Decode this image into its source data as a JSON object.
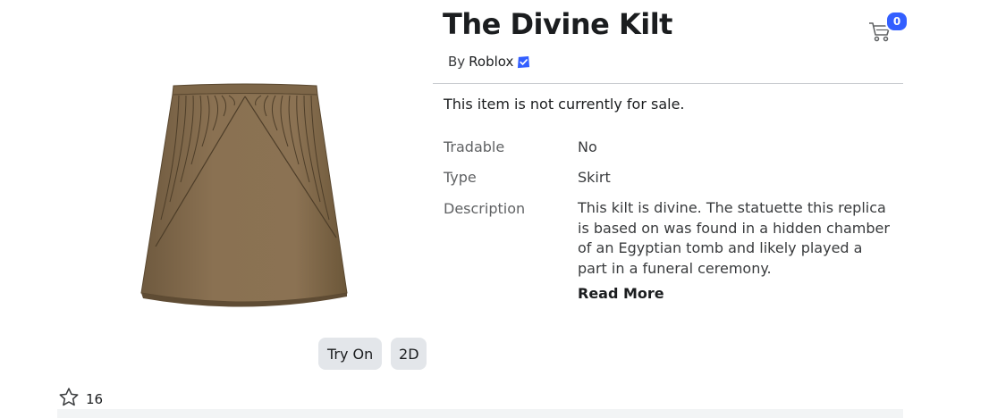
{
  "item": {
    "title": "The Divine Kilt",
    "by_prefix": "By",
    "creator": "Roblox",
    "sale_status": "This item is not currently for sale."
  },
  "cart": {
    "count": "0"
  },
  "details": [
    {
      "label": "Tradable",
      "value": "No"
    },
    {
      "label": "Type",
      "value": "Skirt"
    },
    {
      "label": "Description",
      "value": "This kilt is divine. The statuette this replica is based on was found in a hidden chamber of an Egyptian tomb and likely played a part in a funeral ceremony."
    }
  ],
  "read_more_label": "Read More",
  "viewer": {
    "try_on_label": "Try On",
    "mode_label": "2D"
  },
  "favorites": {
    "count": "16"
  },
  "icons": {
    "cart": "cart-icon",
    "verified": "verified-badge-icon",
    "favorite": "star-outline-icon"
  },
  "colors": {
    "badge_blue": "#335fff",
    "skirt_brown": "#8a7152"
  }
}
